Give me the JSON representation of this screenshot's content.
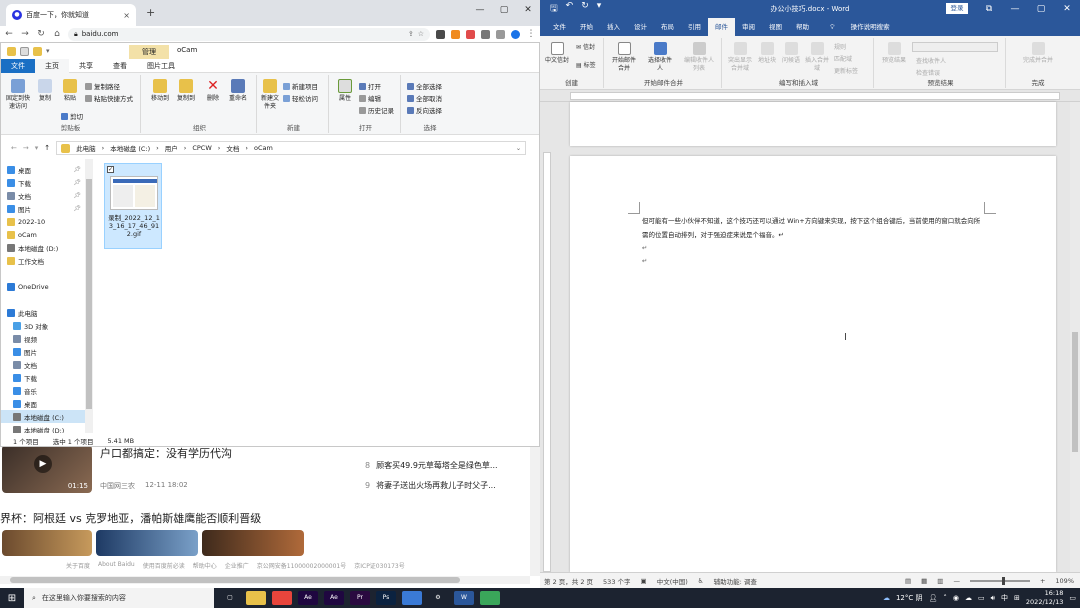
{
  "chrome": {
    "tab_title": "百度一下，你就知道",
    "url": "baidu.com",
    "news": [
      {
        "rank": "8",
        "text": "顾客买49.9元草莓塔全是绿色草..."
      },
      {
        "rank": "9",
        "text": "将妻子送出火场再救儿子时父子..."
      }
    ],
    "headline1": "户口都搞定：没有学历代沟",
    "source1": "中国网三农",
    "date1": "12-11 18:02",
    "video_time": "01:15",
    "headline2": "界杯：阿根廷 vs 克罗地亚，潘帕斯雄鹰能否顺利晋级",
    "footer": [
      "关于百度",
      "About Baidu",
      "使用百度前必读",
      "帮助中心",
      "企业推广",
      "京公网安备11000002000001号",
      "京ICP证030173号"
    ]
  },
  "explorer": {
    "title_tab": "管理",
    "title_name": "oCam",
    "tabs": [
      "文件",
      "主页",
      "共享",
      "查看",
      "图片工具"
    ],
    "ribbon": {
      "pin": "固定到快速访问",
      "copy": "复制",
      "paste": "粘贴",
      "copy_path": "复制路径",
      "paste_shortcut": "粘贴快捷方式",
      "cut": "剪切",
      "clipboard": "剪贴板",
      "move_to": "移动到",
      "copy_to": "复制到",
      "delete": "删除",
      "rename": "重命名",
      "organize": "组织",
      "new_folder": "新建文件夹",
      "new_item": "新建项目",
      "easy_access": "轻松访问",
      "new": "新建",
      "properties": "属性",
      "open": "打开",
      "edit": "编辑",
      "history": "历史记录",
      "open_group": "打开",
      "select_all": "全部选择",
      "select_none": "全部取消",
      "invert": "反向选择",
      "select": "选择"
    },
    "breadcrumb": [
      "此电脑",
      "本地磁盘 (C:)",
      "用户",
      "CPCW",
      "文档",
      "oCam"
    ],
    "nav": [
      {
        "label": "桌面",
        "color": "#3a8ee6",
        "pin": true
      },
      {
        "label": "下载",
        "color": "#3a8ee6",
        "pin": true
      },
      {
        "label": "文档",
        "color": "#7a8ca8",
        "pin": true
      },
      {
        "label": "图片",
        "color": "#3a8ee6",
        "pin": true
      },
      {
        "label": "2022-10",
        "color": "#e8c14a"
      },
      {
        "label": "oCam",
        "color": "#e8c14a"
      },
      {
        "label": "本地磁盘 (D:)",
        "color": "#777"
      },
      {
        "label": "工作文档",
        "color": "#e8c14a"
      },
      {
        "label": "",
        "color": ""
      },
      {
        "label": "OneDrive",
        "color": "#2c7ad6"
      },
      {
        "label": "",
        "color": ""
      },
      {
        "label": "此电脑",
        "color": "#2c7ad6"
      },
      {
        "label": "3D 对象",
        "color": "#4aa0e6"
      },
      {
        "label": "视频",
        "color": "#7a8ca8"
      },
      {
        "label": "图片",
        "color": "#3a8ee6"
      },
      {
        "label": "文档",
        "color": "#7a8ca8"
      },
      {
        "label": "下载",
        "color": "#3a8ee6"
      },
      {
        "label": "音乐",
        "color": "#3a8ee6"
      },
      {
        "label": "桌面",
        "color": "#3a8ee6"
      },
      {
        "label": "本地磁盘 (C:)",
        "color": "#777",
        "sel": true
      },
      {
        "label": "本地磁盘 (D:)",
        "color": "#777"
      }
    ],
    "file_name": "录制_2022_12_13_16_17_46_912.gif",
    "status": [
      "1 个项目",
      "选中 1 个项目",
      "5.41 MB"
    ]
  },
  "word": {
    "doc_title": "办公小技巧.docx - Word",
    "login": "登录",
    "tabs": [
      "文件",
      "开始",
      "插入",
      "设计",
      "布局",
      "引用",
      "邮件",
      "审阅",
      "视图",
      "帮助",
      "操作说明搜索"
    ],
    "active_tab": "邮件",
    "ribbon": {
      "zh_envelope": "中文信封",
      "envelope": "信封",
      "label": "标签",
      "create": "创建",
      "start_merge": "开始邮件合并",
      "select_recipients": "选择收件人",
      "edit_recipients": "编辑收件人列表",
      "start_group": "开始邮件合并",
      "highlight": "突出显示合并域",
      "address_block": "地址块",
      "greeting": "问候语",
      "insert_field": "插入合并域",
      "rules": "规则",
      "match": "匹配域",
      "update": "更新标签",
      "write_group": "编写和插入域",
      "preview": "预览结果",
      "find_recipient": "查找收件人",
      "check_errors": "检查错误",
      "preview_group": "预览结果",
      "finish_merge": "完成并合并",
      "finish_group": "完成"
    },
    "body": "但可能有一些小伙伴不知道，这个技巧还可以通过 Win+方向键来实现，按下这个组合键后，当前使用的窗口就会向所需的位置自动排列，对于强迫症来说是个福音。↵",
    "status": [
      "第 2 页，共 2 页",
      "533 个字",
      "中文(中国)",
      "辅助功能: 调查"
    ],
    "zoom": "109%"
  },
  "taskbar": {
    "search_placeholder": "在这里输入你要搜索的内容",
    "apps": [
      {
        "name": "task-view",
        "color": "#1c2330",
        "txt": "▢"
      },
      {
        "name": "file-explorer",
        "color": "#e8c14a",
        "txt": ""
      },
      {
        "name": "chrome",
        "color": "#e8453c",
        "txt": ""
      },
      {
        "name": "after-effects",
        "color": "#1f0740",
        "txt": "Ae"
      },
      {
        "name": "after-effects-2",
        "color": "#1f0740",
        "txt": "Ae"
      },
      {
        "name": "premiere",
        "color": "#2a0a40",
        "txt": "Pr"
      },
      {
        "name": "photoshop",
        "color": "#0b2240",
        "txt": "Ps"
      },
      {
        "name": "app-blue",
        "color": "#3a7ad6",
        "txt": ""
      },
      {
        "name": "settings",
        "color": "#1c2330",
        "txt": "⚙"
      },
      {
        "name": "word",
        "color": "#2b579a",
        "txt": "W"
      },
      {
        "name": "app-green",
        "color": "#3aa65a",
        "txt": ""
      }
    ],
    "weather": "12°C 阴",
    "ime": "中",
    "time": "16:18",
    "date": "2022/12/13"
  }
}
